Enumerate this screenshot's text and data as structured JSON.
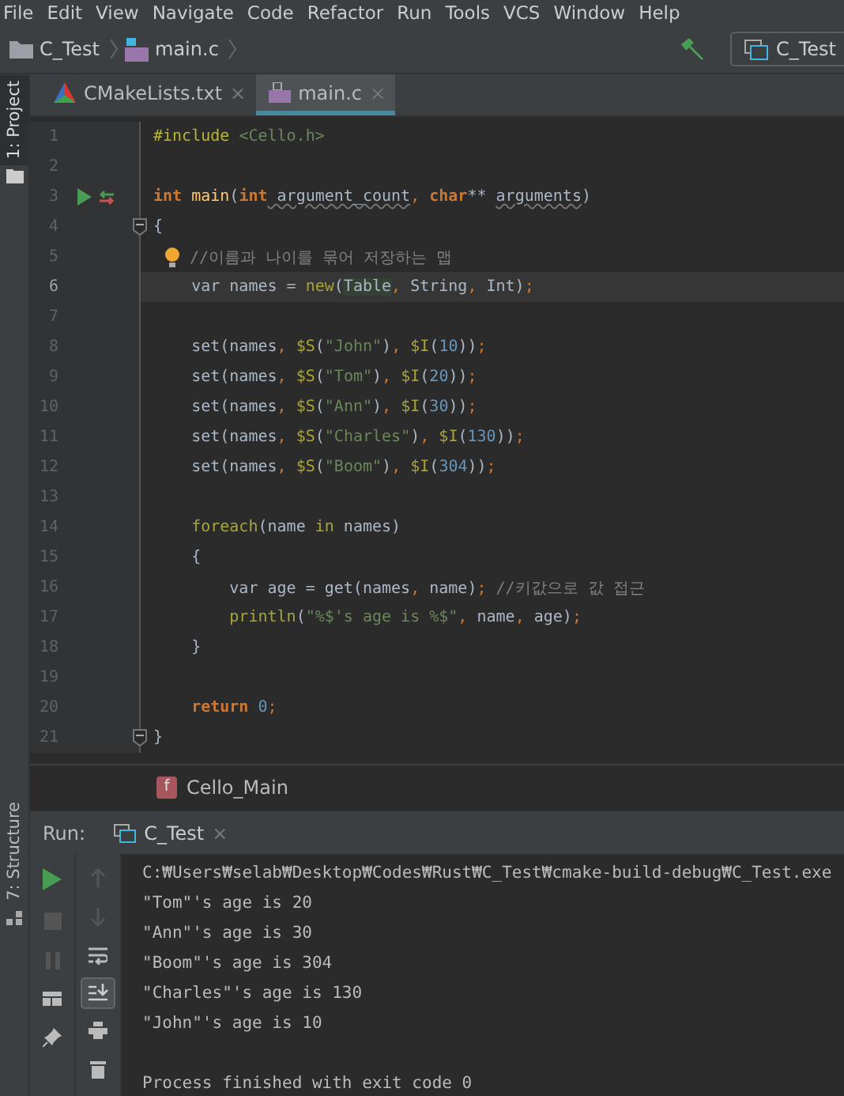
{
  "menu": [
    "File",
    "Edit",
    "View",
    "Navigate",
    "Code",
    "Refactor",
    "Run",
    "Tools",
    "VCS",
    "Window",
    "Help"
  ],
  "navbar": {
    "project": "C_Test",
    "file": "main.c",
    "run_config": "C_Test"
  },
  "side_tools": {
    "top": "1: Project",
    "bottom": "7: Structure"
  },
  "tabs": [
    {
      "label": "CMakeLists.txt",
      "kind": "cmake",
      "selected": false,
      "close": "×"
    },
    {
      "label": "main.c",
      "kind": "c",
      "selected": true,
      "close": "×"
    }
  ],
  "code": [
    {
      "number": "1",
      "kind": "plain",
      "current": false,
      "tokens": [
        {
          "kind": "directive",
          "text": "#include "
        },
        {
          "kind": "str",
          "text": "<Cello.h>"
        }
      ]
    },
    {
      "number": "2",
      "kind": "plain",
      "current": false
    },
    {
      "number": "3",
      "kind": "run",
      "current": false,
      "tokens": [
        {
          "kind": "kw",
          "text": "int"
        },
        {
          "kind": "fn",
          "text": " main"
        },
        {
          "kind": "plain",
          "text": "("
        },
        {
          "kind": "kw",
          "text": "int"
        },
        {
          "kind": "param",
          "text": " argument_count"
        },
        {
          "kind": "punct",
          "text": ", "
        },
        {
          "kind": "kw",
          "text": "char"
        },
        {
          "kind": "plain",
          "text": "** "
        },
        {
          "kind": "param",
          "text": "arguments"
        },
        {
          "kind": "plain",
          "text": ")"
        }
      ]
    },
    {
      "number": "4",
      "kind": "fold",
      "current": false,
      "tokens": [
        {
          "kind": "plain",
          "text": "{"
        }
      ]
    },
    {
      "number": "5",
      "kind": "hint",
      "current": false,
      "tokens": [
        {
          "kind": "comment",
          "text": "//이름과 나이를 묶어 저장하는 맵"
        }
      ]
    },
    {
      "number": "6",
      "kind": "plain",
      "current": true,
      "tokens": [
        {
          "kind": "plain",
          "text": "    var names = "
        },
        {
          "kind": "macro",
          "text": "new"
        },
        {
          "kind": "plain",
          "text": "("
        },
        {
          "kind": "ref",
          "text": "Table"
        },
        {
          "kind": "punct",
          "text": ", "
        },
        {
          "kind": "plain",
          "text": "String"
        },
        {
          "kind": "punct",
          "text": ", "
        },
        {
          "kind": "plain",
          "text": "Int)"
        },
        {
          "kind": "punct",
          "text": ";"
        }
      ]
    },
    {
      "number": "7",
      "kind": "plain",
      "current": false
    },
    {
      "number": "8",
      "kind": "plain",
      "current": false,
      "tokens": [
        {
          "kind": "plain",
          "text": "    set(names"
        },
        {
          "kind": "punct",
          "text": ", "
        },
        {
          "kind": "macro",
          "text": "$S"
        },
        {
          "kind": "plain",
          "text": "("
        },
        {
          "kind": "str",
          "text": "\"John\""
        },
        {
          "kind": "plain",
          "text": ")"
        },
        {
          "kind": "punct",
          "text": ", "
        },
        {
          "kind": "macro",
          "text": "$I"
        },
        {
          "kind": "plain",
          "text": "("
        },
        {
          "kind": "num",
          "text": "10"
        },
        {
          "kind": "plain",
          "text": "))"
        },
        {
          "kind": "punct",
          "text": ";"
        }
      ]
    },
    {
      "number": "9",
      "kind": "plain",
      "current": false,
      "tokens": [
        {
          "kind": "plain",
          "text": "    set(names"
        },
        {
          "kind": "punct",
          "text": ", "
        },
        {
          "kind": "macro",
          "text": "$S"
        },
        {
          "kind": "plain",
          "text": "("
        },
        {
          "kind": "str",
          "text": "\"Tom\""
        },
        {
          "kind": "plain",
          "text": ")"
        },
        {
          "kind": "punct",
          "text": ", "
        },
        {
          "kind": "macro",
          "text": "$I"
        },
        {
          "kind": "plain",
          "text": "("
        },
        {
          "kind": "num",
          "text": "20"
        },
        {
          "kind": "plain",
          "text": "))"
        },
        {
          "kind": "punct",
          "text": ";"
        }
      ]
    },
    {
      "number": "10",
      "kind": "plain",
      "current": false,
      "tokens": [
        {
          "kind": "plain",
          "text": "    set(names"
        },
        {
          "kind": "punct",
          "text": ", "
        },
        {
          "kind": "macro",
          "text": "$S"
        },
        {
          "kind": "plain",
          "text": "("
        },
        {
          "kind": "str",
          "text": "\"Ann\""
        },
        {
          "kind": "plain",
          "text": ")"
        },
        {
          "kind": "punct",
          "text": ", "
        },
        {
          "kind": "macro",
          "text": "$I"
        },
        {
          "kind": "plain",
          "text": "("
        },
        {
          "kind": "num",
          "text": "30"
        },
        {
          "kind": "plain",
          "text": "))"
        },
        {
          "kind": "punct",
          "text": ";"
        }
      ]
    },
    {
      "number": "11",
      "kind": "plain",
      "current": false,
      "tokens": [
        {
          "kind": "plain",
          "text": "    set(names"
        },
        {
          "kind": "punct",
          "text": ", "
        },
        {
          "kind": "macro",
          "text": "$S"
        },
        {
          "kind": "plain",
          "text": "("
        },
        {
          "kind": "str",
          "text": "\"Charles\""
        },
        {
          "kind": "plain",
          "text": ")"
        },
        {
          "kind": "punct",
          "text": ", "
        },
        {
          "kind": "macro",
          "text": "$I"
        },
        {
          "kind": "plain",
          "text": "("
        },
        {
          "kind": "num",
          "text": "130"
        },
        {
          "kind": "plain",
          "text": "))"
        },
        {
          "kind": "punct",
          "text": ";"
        }
      ]
    },
    {
      "number": "12",
      "kind": "plain",
      "current": false,
      "tokens": [
        {
          "kind": "plain",
          "text": "    set(names"
        },
        {
          "kind": "punct",
          "text": ", "
        },
        {
          "kind": "macro",
          "text": "$S"
        },
        {
          "kind": "plain",
          "text": "("
        },
        {
          "kind": "str",
          "text": "\"Boom\""
        },
        {
          "kind": "plain",
          "text": ")"
        },
        {
          "kind": "punct",
          "text": ", "
        },
        {
          "kind": "macro",
          "text": "$I"
        },
        {
          "kind": "plain",
          "text": "("
        },
        {
          "kind": "num",
          "text": "304"
        },
        {
          "kind": "plain",
          "text": "))"
        },
        {
          "kind": "punct",
          "text": ";"
        }
      ]
    },
    {
      "number": "13",
      "kind": "plain",
      "current": false
    },
    {
      "number": "14",
      "kind": "plain",
      "current": false,
      "tokens": [
        {
          "kind": "macro",
          "text": "    foreach"
        },
        {
          "kind": "plain",
          "text": "(name "
        },
        {
          "kind": "macro",
          "text": "in"
        },
        {
          "kind": "plain",
          "text": " names)"
        }
      ]
    },
    {
      "number": "15",
      "kind": "plain",
      "current": false,
      "tokens": [
        {
          "kind": "plain",
          "text": "    {"
        }
      ]
    },
    {
      "number": "16",
      "kind": "plain",
      "current": false,
      "tokens": [
        {
          "kind": "plain",
          "text": "        var age = get(names"
        },
        {
          "kind": "punct",
          "text": ", "
        },
        {
          "kind": "plain",
          "text": "name)"
        },
        {
          "kind": "punct",
          "text": ";"
        },
        {
          "kind": "comment",
          "text": " //키값으로 값 접근"
        }
      ]
    },
    {
      "number": "17",
      "kind": "plain",
      "current": false,
      "tokens": [
        {
          "kind": "macro",
          "text": "        println"
        },
        {
          "kind": "plain",
          "text": "("
        },
        {
          "kind": "str",
          "text": "\"%$'s age is %$\""
        },
        {
          "kind": "punct",
          "text": ", "
        },
        {
          "kind": "plain",
          "text": "name"
        },
        {
          "kind": "punct",
          "text": ", "
        },
        {
          "kind": "plain",
          "text": "age)"
        },
        {
          "kind": "punct",
          "text": ";"
        }
      ]
    },
    {
      "number": "18",
      "kind": "plain",
      "current": false,
      "tokens": [
        {
          "kind": "plain",
          "text": "    }"
        }
      ]
    },
    {
      "number": "19",
      "kind": "plain",
      "current": false
    },
    {
      "number": "20",
      "kind": "plain",
      "current": false,
      "tokens": [
        {
          "kind": "kw",
          "text": "    return"
        },
        {
          "kind": "num",
          "text": " 0"
        },
        {
          "kind": "punct",
          "text": ";"
        }
      ]
    },
    {
      "number": "21",
      "kind": "fold",
      "current": false,
      "tokens": [
        {
          "kind": "plain",
          "text": "}"
        }
      ]
    }
  ],
  "breadcrumb": {
    "badge": "f",
    "label": "Cello_Main"
  },
  "run": {
    "label": "Run:",
    "tab": "C_Test",
    "close": "×",
    "output": [
      "C:₩Users₩selab₩Desktop₩Codes₩Rust₩C_Test₩cmake-build-debug₩C_Test.exe",
      "\"Tom\"'s age is 20",
      "\"Ann\"'s age is 30",
      "\"Boom\"'s age is 304",
      "\"Charles\"'s age is 130",
      "\"John\"'s age is 10"
    ],
    "status": "Process finished with exit code 0"
  }
}
